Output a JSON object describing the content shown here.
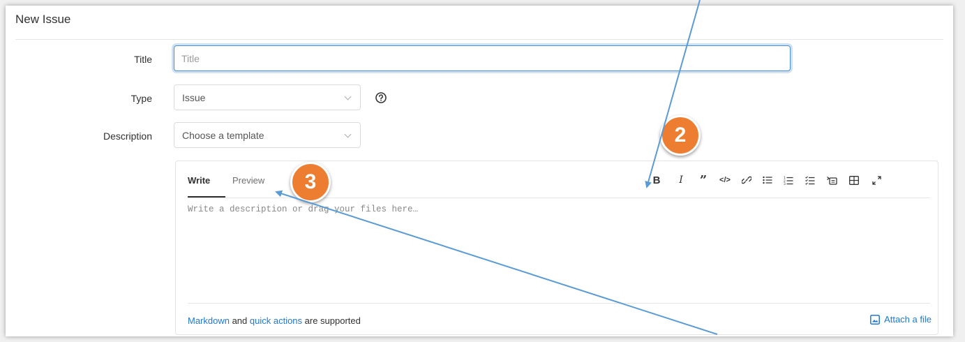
{
  "page": {
    "title": "New Issue"
  },
  "form": {
    "title_label": "Title",
    "title_placeholder": "Title",
    "type_label": "Type",
    "type_value": "Issue",
    "description_label": "Description",
    "template_value": "Choose a template"
  },
  "editor": {
    "tabs": {
      "write": "Write",
      "preview": "Preview"
    },
    "toolbar": [
      "bold-icon",
      "italic-icon",
      "quote-icon",
      "code-icon",
      "link-icon",
      "bullet-list-icon",
      "numbered-list-icon",
      "task-list-icon",
      "collapsible-icon",
      "table-icon",
      "fullscreen-icon"
    ],
    "placeholder": "Write a description or drag your files here…",
    "footer": {
      "markdown_link": "Markdown",
      "and_text": " and ",
      "quick_actions_link": "quick actions",
      "supported_text": " are supported",
      "attach_label": "Attach a file"
    }
  },
  "annotations": {
    "badge_2": "2",
    "badge_3": "3",
    "accent_color": "#ed7d31",
    "arrow_color": "#5b9bd5"
  }
}
